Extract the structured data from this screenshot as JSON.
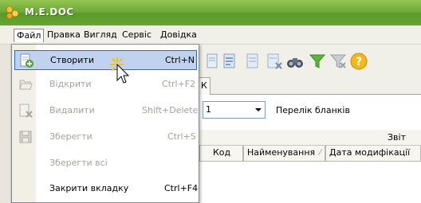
{
  "app": {
    "title": "M.E.DOC"
  },
  "menubar": {
    "items": [
      {
        "label": "Файл"
      },
      {
        "label": "Правка"
      },
      {
        "label": "Вигляд"
      },
      {
        "label": "Сервіс"
      },
      {
        "label": "Довідка"
      }
    ]
  },
  "file_menu": {
    "items": [
      {
        "label": "Створити",
        "shortcut": "Ctrl+N"
      },
      {
        "label": "Відкрити",
        "shortcut": "Ctrl+F2"
      },
      {
        "label": "Видалити",
        "shortcut": "Shift+Delete"
      },
      {
        "label": "Зберегти",
        "shortcut": "Ctrl+S"
      },
      {
        "label": "Зберегти всі",
        "shortcut": ""
      },
      {
        "label": "Закрити вкладку",
        "shortcut": "Ctrl+F4"
      }
    ]
  },
  "tab": {
    "fragment": "К"
  },
  "filter": {
    "combo_value": "1",
    "list_label": "Перелік бланків"
  },
  "grid": {
    "group_header": "Звіт",
    "columns": [
      "Код",
      "Найменування",
      "Дата модифікації"
    ]
  },
  "colors": {
    "titlebar": "#6eaa36",
    "menu_highlight": "#c1d2ee",
    "menu_highlight_border": "#316ac5",
    "disabled_text": "#a5a49b"
  }
}
